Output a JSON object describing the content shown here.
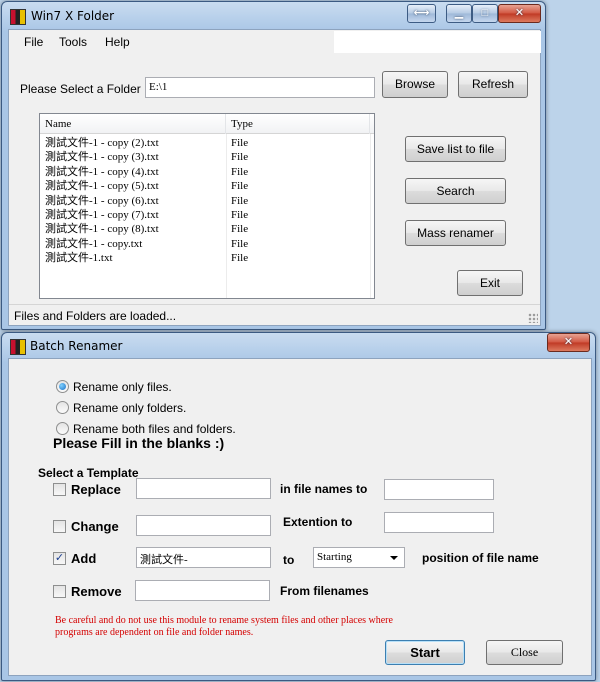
{
  "main_window": {
    "title": "Win7 X Folder",
    "menu": [
      "File",
      "Tools",
      "Help"
    ],
    "folder_label": "Please Select a Folder",
    "folder_value": "E:\\1",
    "browse_label": "Browse",
    "refresh_label": "Refresh",
    "save_list_label": "Save list to file",
    "search_label": "Search",
    "mass_renamer_label": "Mass renamer",
    "exit_label": "Exit",
    "list": {
      "columns": [
        "Name",
        "Type"
      ],
      "rows": [
        {
          "name": "測試文件-1 - copy (2).txt",
          "type": "File"
        },
        {
          "name": "測試文件-1 - copy (3).txt",
          "type": "File"
        },
        {
          "name": "測試文件-1 - copy (4).txt",
          "type": "File"
        },
        {
          "name": "測試文件-1 - copy (5).txt",
          "type": "File"
        },
        {
          "name": "測試文件-1 - copy (6).txt",
          "type": "File"
        },
        {
          "name": "測試文件-1 - copy (7).txt",
          "type": "File"
        },
        {
          "name": "測試文件-1 - copy (8).txt",
          "type": "File"
        },
        {
          "name": "測試文件-1 - copy.txt",
          "type": "File"
        },
        {
          "name": "測試文件-1.txt",
          "type": "File"
        }
      ]
    },
    "status": "Files and Folders are loaded..."
  },
  "batch_window": {
    "title": "Batch Renamer",
    "options": [
      {
        "label": "Rename only files.",
        "selected": true
      },
      {
        "label": "Rename only folders.",
        "selected": false
      },
      {
        "label": "Rename both files and folders.",
        "selected": false
      }
    ],
    "instruction": "Please Fill in the blanks :)",
    "template_label": "Select a Template",
    "replace": {
      "label": "Replace",
      "checked": false,
      "value1": "",
      "mid_label": "in file names to",
      "value2": ""
    },
    "change": {
      "label": "Change",
      "checked": false,
      "value1": "",
      "mid_label": "Extention to",
      "value2": ""
    },
    "add": {
      "label": "Add",
      "checked": true,
      "value1": "測試文件-",
      "mid_label": "to",
      "position": "Starting",
      "end_label": "position of file name"
    },
    "remove": {
      "label": "Remove",
      "checked": false,
      "value1": "",
      "mid_label": "From filenames"
    },
    "warning": "Be careful and do not use this module to rename system files and other places where programs are dependent on file and folder names.",
    "start_label": "Start",
    "close_label": "Close"
  },
  "colors": {
    "warning": "#d40000",
    "frame": "#a9c6e6",
    "client": "#f0f0f0"
  }
}
